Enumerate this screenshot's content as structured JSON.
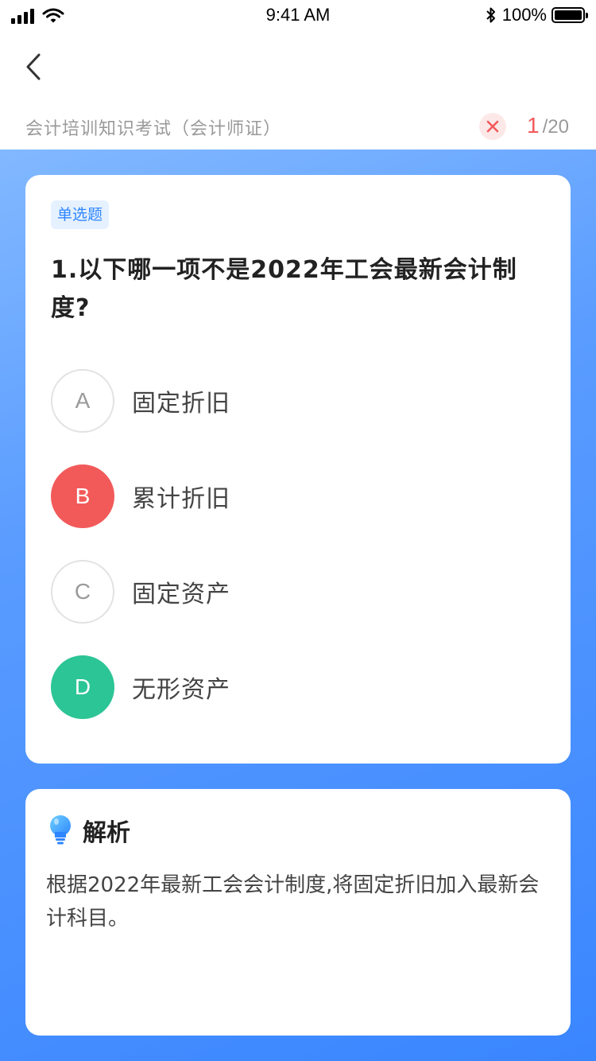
{
  "status_bar": {
    "time": "9:41 AM",
    "battery": "100%",
    "icons": [
      "signal-icon",
      "wifi-icon",
      "bluetooth-icon",
      "battery-icon"
    ]
  },
  "nav": {
    "back_icon": "chevron-left-icon"
  },
  "header": {
    "exam_title": "会计培训知识考试（会计师证）",
    "wrong_icon": "close-icon",
    "current": "1",
    "total": "/20"
  },
  "question": {
    "type_label": "单选题",
    "text": "1.以下哪一项不是2022年工会最新会计制度?",
    "options": [
      {
        "letter": "A",
        "label": "固定折旧",
        "state": "default"
      },
      {
        "letter": "B",
        "label": "累计折旧",
        "state": "wrong"
      },
      {
        "letter": "C",
        "label": "固定资产",
        "state": "default"
      },
      {
        "letter": "D",
        "label": "无形资产",
        "state": "correct"
      }
    ]
  },
  "analysis": {
    "icon": "lightbulb-icon",
    "title": "解析",
    "text": "根据2022年最新工会会计制度,将固定折旧加入最新会计科目。"
  },
  "colors": {
    "accent_blue": "#3a86ff",
    "wrong_red": "#f25a5a",
    "correct_green": "#2cc595"
  }
}
